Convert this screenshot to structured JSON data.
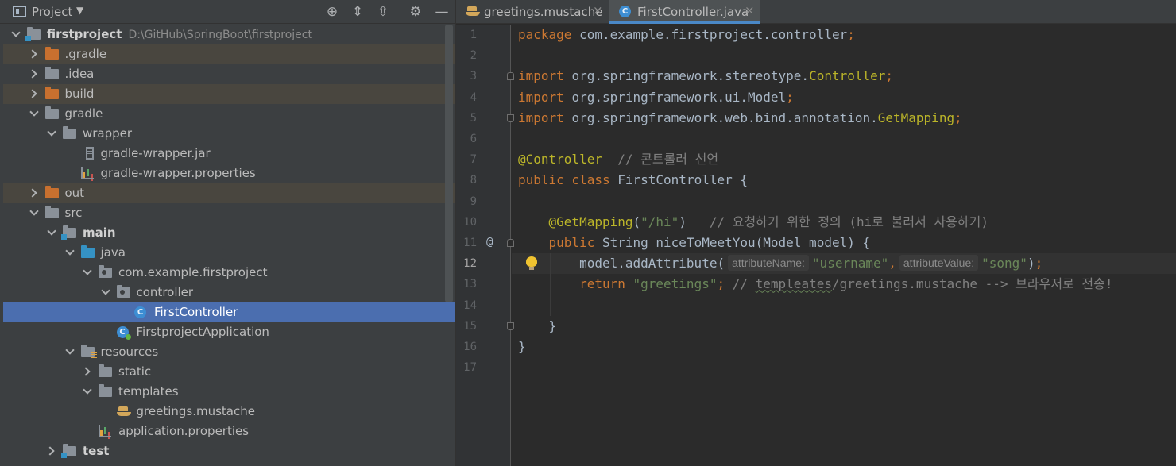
{
  "project_panel": {
    "title": "Project",
    "dropdown_glyph": "▼",
    "toolbar": [
      {
        "name": "locate-icon",
        "glyph": "⊕"
      },
      {
        "name": "expand-all-icon",
        "glyph": "⇕"
      },
      {
        "name": "collapse-all-icon",
        "glyph": "⇳"
      },
      {
        "name": "gear-icon",
        "glyph": "⚙"
      },
      {
        "name": "hide-icon",
        "glyph": "—"
      }
    ],
    "tree": [
      {
        "label": "firstproject",
        "path": "D:\\GitHub\\SpringBoot\\firstproject",
        "depth": 0,
        "chevron": "down",
        "icon": "folder-module-icon",
        "bold": true
      },
      {
        "label": ".gradle",
        "depth": 1,
        "chevron": "right",
        "icon": "folder-orange-icon",
        "excluded": true
      },
      {
        "label": ".idea",
        "depth": 1,
        "chevron": "right",
        "icon": "folder-icon"
      },
      {
        "label": "build",
        "depth": 1,
        "chevron": "right",
        "icon": "folder-orange-icon",
        "excluded": true
      },
      {
        "label": "gradle",
        "depth": 1,
        "chevron": "down",
        "icon": "folder-icon"
      },
      {
        "label": "wrapper",
        "depth": 2,
        "chevron": "down",
        "icon": "folder-icon"
      },
      {
        "label": "gradle-wrapper.jar",
        "depth": 3,
        "chevron": "",
        "icon": "jar-icon"
      },
      {
        "label": "gradle-wrapper.properties",
        "depth": 3,
        "chevron": "",
        "icon": "properties-icon"
      },
      {
        "label": "out",
        "depth": 1,
        "chevron": "right",
        "icon": "folder-orange-icon",
        "excluded": true
      },
      {
        "label": "src",
        "depth": 1,
        "chevron": "down",
        "icon": "folder-icon"
      },
      {
        "label": "main",
        "depth": 2,
        "chevron": "down",
        "icon": "folder-module-icon",
        "bold": true
      },
      {
        "label": "java",
        "depth": 3,
        "chevron": "down",
        "icon": "folder-blue-icon"
      },
      {
        "label": "com.example.firstproject",
        "depth": 4,
        "chevron": "down",
        "icon": "package-icon"
      },
      {
        "label": "controller",
        "depth": 5,
        "chevron": "down",
        "icon": "package-icon"
      },
      {
        "label": "FirstController",
        "depth": 6,
        "chevron": "",
        "icon": "class-icon",
        "selected": true
      },
      {
        "label": "FirstprojectApplication",
        "depth": 5,
        "chevron": "",
        "icon": "spring-class-icon"
      },
      {
        "label": "resources",
        "depth": 3,
        "chevron": "down",
        "icon": "folder-resources-icon"
      },
      {
        "label": "static",
        "depth": 4,
        "chevron": "right",
        "icon": "folder-icon"
      },
      {
        "label": "templates",
        "depth": 4,
        "chevron": "down",
        "icon": "folder-icon"
      },
      {
        "label": "greetings.mustache",
        "depth": 5,
        "chevron": "",
        "icon": "mustache-icon"
      },
      {
        "label": "application.properties",
        "depth": 4,
        "chevron": "",
        "icon": "properties-icon"
      },
      {
        "label": "test",
        "depth": 2,
        "chevron": "right",
        "icon": "folder-module-icon",
        "bold": true
      }
    ]
  },
  "editor": {
    "tabs": [
      {
        "label": "greetings.mustache",
        "icon": "mustache-icon",
        "close": "×",
        "active": false
      },
      {
        "label": "FirstController.java",
        "icon": "class-icon",
        "close": "×",
        "active": true
      }
    ],
    "class_icon_letter": "C",
    "current_line": 12,
    "at_marker": "@",
    "lines": [
      [
        {
          "t": "kw",
          "v": "package "
        },
        {
          "t": "pl",
          "v": "com.example.firstproject.controller"
        },
        {
          "t": "kw",
          "v": ";"
        }
      ],
      [],
      [
        {
          "t": "kw",
          "v": "import "
        },
        {
          "t": "pl",
          "v": "org.springframework.stereotype."
        },
        {
          "t": "ann",
          "v": "Controller"
        },
        {
          "t": "kw",
          "v": ";"
        }
      ],
      [
        {
          "t": "kw",
          "v": "import "
        },
        {
          "t": "pl",
          "v": "org.springframework.ui.Model"
        },
        {
          "t": "kw",
          "v": ";"
        }
      ],
      [
        {
          "t": "kw",
          "v": "import "
        },
        {
          "t": "pl",
          "v": "org.springframework.web.bind.annotation."
        },
        {
          "t": "ann",
          "v": "GetMapping"
        },
        {
          "t": "kw",
          "v": ";"
        }
      ],
      [],
      [
        {
          "t": "ann",
          "v": "@Controller"
        },
        {
          "t": "cmt",
          "v": "  // 콘트롤러 선언"
        }
      ],
      [
        {
          "t": "kw",
          "v": "public class "
        },
        {
          "t": "pl",
          "v": "FirstController {"
        }
      ],
      [],
      [
        {
          "t": "pl",
          "v": "    "
        },
        {
          "t": "ann",
          "v": "@GetMapping"
        },
        {
          "t": "pl",
          "v": "("
        },
        {
          "t": "str",
          "v": "\"/hi\""
        },
        {
          "t": "pl",
          "v": ")   "
        },
        {
          "t": "cmt",
          "v": "// 요청하기 위한 정의 (hi로 불러서 사용하기)"
        }
      ],
      [
        {
          "t": "pl",
          "v": "    "
        },
        {
          "t": "kw",
          "v": "public "
        },
        {
          "t": "pl",
          "v": "String niceToMeetYou(Model model) {"
        }
      ],
      [
        {
          "t": "pl",
          "v": "        model.addAttribute("
        },
        {
          "t": "hint",
          "v": "attributeName:"
        },
        {
          "t": "str",
          "v": "\"username\""
        },
        {
          "t": "kw",
          "v": ","
        },
        {
          "t": "hint",
          "v": "attributeValue:"
        },
        {
          "t": "str",
          "v": "\"song\""
        },
        {
          "t": "pl",
          "v": ")"
        },
        {
          "t": "kw",
          "v": ";"
        }
      ],
      [
        {
          "t": "pl",
          "v": "        "
        },
        {
          "t": "kw",
          "v": "return "
        },
        {
          "t": "str",
          "v": "\"greetings\""
        },
        {
          "t": "kw",
          "v": "; "
        },
        {
          "t": "cmt",
          "v": "// "
        },
        {
          "t": "typo",
          "v": "templeates"
        },
        {
          "t": "cmt",
          "v": "/greetings.mustache --> 브라우저로 전송!"
        }
      ],
      [],
      [
        {
          "t": "pl",
          "v": "    }"
        }
      ],
      [
        {
          "t": "pl",
          "v": "}"
        }
      ],
      []
    ]
  },
  "colors": {
    "panel_bg": "#3c3f41",
    "editor_bg": "#2b2b2b",
    "selection": "#4b6eaf",
    "excluded_row": "#49463f",
    "keyword": "#cc7832",
    "annotation": "#bbb529",
    "string": "#6a8759",
    "comment": "#808080"
  }
}
